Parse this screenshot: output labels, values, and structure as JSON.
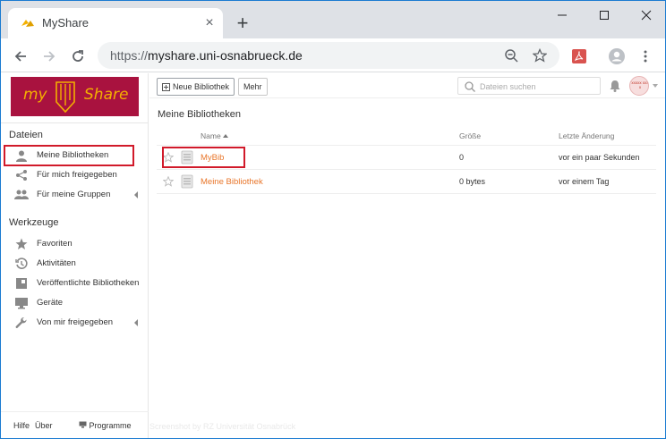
{
  "browser": {
    "tab_title": "MyShare",
    "tab_close": "×",
    "new_tab": "+",
    "url_protocol": "https://",
    "url_host": "myshare.uni-osnabrueck.de"
  },
  "sidebar": {
    "logo_left": "my",
    "logo_right": "Share",
    "section1_heading": "Dateien",
    "section1_items": [
      {
        "label": "Meine Bibliotheken",
        "icon": "user-icon"
      },
      {
        "label": "Für mich freigegeben",
        "icon": "share-icon"
      },
      {
        "label": "Für meine Gruppen",
        "icon": "group-icon"
      }
    ],
    "section2_heading": "Werkzeuge",
    "section2_items": [
      {
        "label": "Favoriten",
        "icon": "star-icon"
      },
      {
        "label": "Aktivitäten",
        "icon": "history-icon"
      },
      {
        "label": "Veröffentlichte Bibliotheken",
        "icon": "wiki-icon"
      },
      {
        "label": "Geräte",
        "icon": "monitor-icon"
      },
      {
        "label": "Von mir freigegeben",
        "icon": "wrench-icon"
      }
    ],
    "footer": {
      "help": "Hilfe",
      "about": "Über",
      "clients": "Programme"
    }
  },
  "main": {
    "new_library_button": "Neue Bibliothek",
    "more_button": "Mehr",
    "search_placeholder": "Dateien suchen",
    "avatar_text": "xxxxx xxx x",
    "section_title": "Meine Bibliotheken",
    "columns": {
      "name": "Name",
      "size": "Größe",
      "modified": "Letzte Änderung"
    },
    "rows": [
      {
        "name": "MyBib",
        "size": "0",
        "modified": "vor ein paar Sekunden"
      },
      {
        "name": "Meine Bibliothek",
        "size": "0 bytes",
        "modified": "vor einem Tag"
      }
    ],
    "watermark": "Screenshot by RZ Universität Osnabrück"
  },
  "colors": {
    "brand": "#a9123f",
    "brand_text": "#f3b000",
    "link": "#e8762b",
    "highlight": "#d11a2a"
  }
}
